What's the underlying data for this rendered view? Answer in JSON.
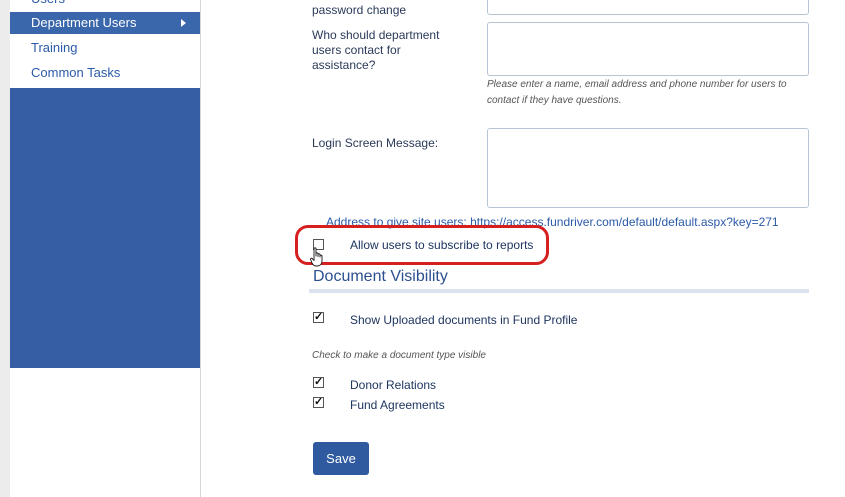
{
  "sidebar": {
    "items": [
      {
        "label": "Users"
      },
      {
        "label": "Department Users"
      },
      {
        "label": "Training"
      },
      {
        "label": "Common Tasks"
      }
    ]
  },
  "form": {
    "password_label": "password change",
    "contact_label": "Who should department users contact for assistance?",
    "contact_hint": "Please enter a name, email address and phone number for users to contact if they have questions.",
    "login_label": "Login Screen Message:",
    "address_prefix": "Address to give site users:",
    "address_url": "https://access.fundriver.com/default/default.aspx?key=271",
    "subscribe_label": "Allow users to subscribe to reports"
  },
  "visibility": {
    "title": "Document Visibility",
    "show_uploaded_label": "Show Uploaded documents in Fund Profile",
    "check_hint": "Check to make a document type visible",
    "doc_types": [
      {
        "label": "Donor Relations",
        "checked": true
      },
      {
        "label": "Fund Agreements",
        "checked": true
      }
    ]
  },
  "buttons": {
    "save": "Save"
  },
  "colors": {
    "accent": "#355ea5",
    "highlight": "#d62020"
  },
  "checkmark": "✓"
}
